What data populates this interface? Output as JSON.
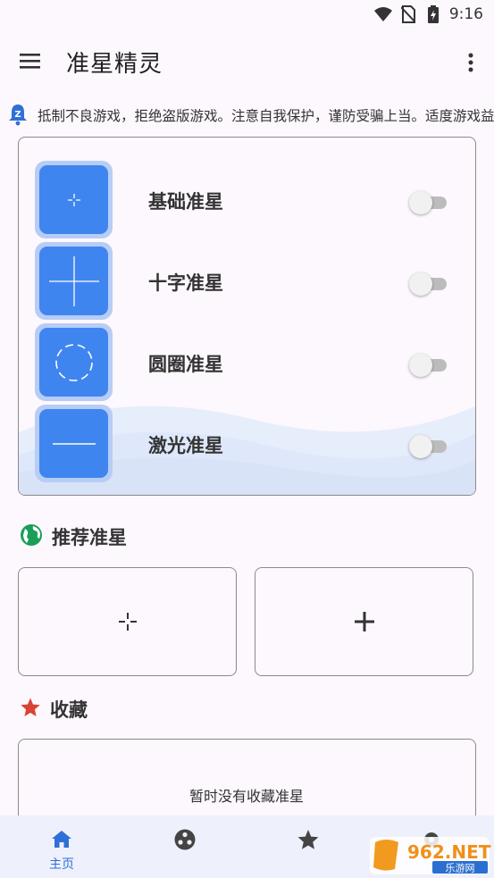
{
  "status_bar": {
    "time": "9:16"
  },
  "app": {
    "title": "准星精灵"
  },
  "notice": {
    "text": "抵制不良游戏，拒绝盗版游戏。注意自我保护，谨防受骗上当。适度游戏益脑，沉迷游戏伤身"
  },
  "crosshairs": [
    {
      "label": "基础准星",
      "icon": "small-crosshair-icon",
      "enabled": false
    },
    {
      "label": "十字准星",
      "icon": "cross-crosshair-icon",
      "enabled": false
    },
    {
      "label": "圆圈准星",
      "icon": "circle-crosshair-icon",
      "enabled": false
    },
    {
      "label": "激光准星",
      "icon": "laser-crosshair-icon",
      "enabled": false
    }
  ],
  "recommended": {
    "title": "推荐准星",
    "icon": "globe-icon",
    "items": [
      "small-crosshair",
      "plus-crosshair"
    ]
  },
  "favorites": {
    "title": "收藏",
    "icon": "star-icon",
    "empty_text": "暂时没有收藏准星"
  },
  "bottom_nav": [
    {
      "label": "主页",
      "icon": "home-icon",
      "active": true
    },
    {
      "label": "",
      "icon": "palette-icon",
      "active": false
    },
    {
      "label": "",
      "icon": "star-icon",
      "active": false
    },
    {
      "label": "",
      "icon": "settings-icon",
      "active": false
    }
  ],
  "watermark": {
    "text": "962.NET",
    "subtext": "乐游网"
  },
  "colors": {
    "accent": "#3f85ef",
    "accent_light": "#b7cdf6",
    "background": "#fdf8fd",
    "nav_background": "#eef1fc",
    "globe": "#1a9e5a",
    "star": "#d94435"
  }
}
